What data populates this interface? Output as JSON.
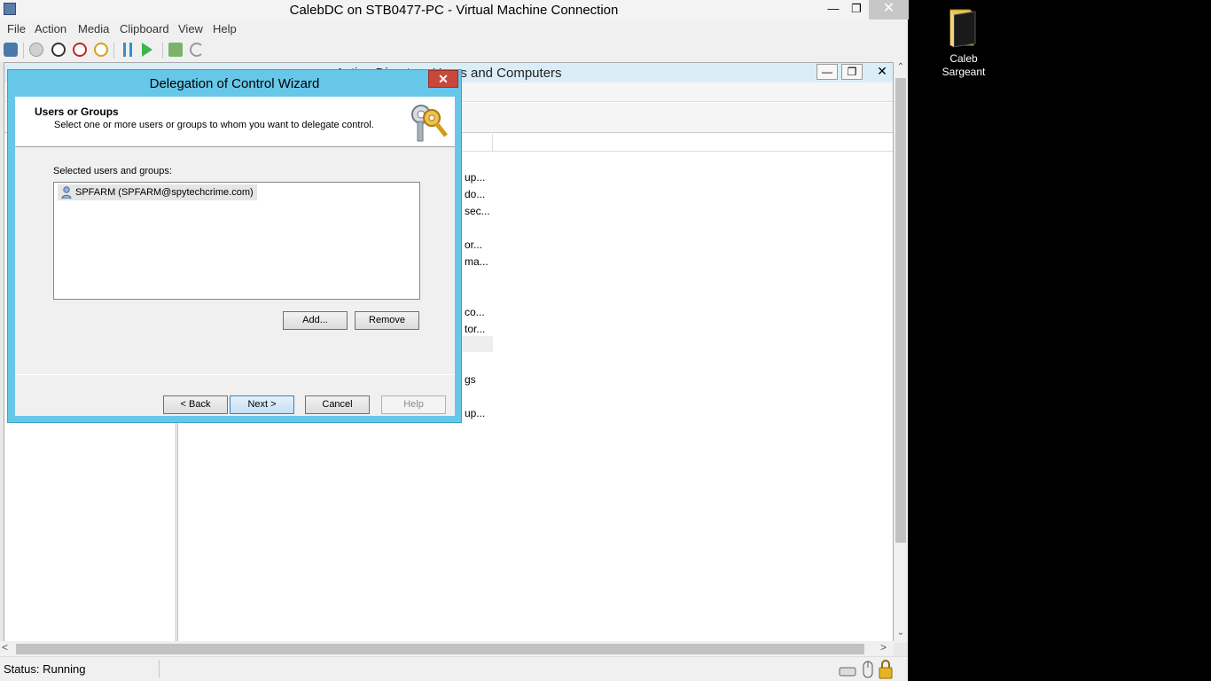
{
  "vm": {
    "title": "CalebDC on STB0477-PC - Virtual Machine Connection",
    "menu": [
      "File",
      "Action",
      "Media",
      "Clipboard",
      "View",
      "Help"
    ],
    "status": "Status: Running"
  },
  "aduc": {
    "title": "Active Directory Users and Computers",
    "descriptions": [
      "up...",
      "do...",
      "sec...",
      "or...",
      "ma...",
      "co...",
      "tor...",
      "gs",
      "up..."
    ]
  },
  "wizard": {
    "title": "Delegation of Control Wizard",
    "heading": "Users or Groups",
    "subheading": "Select one or more users or groups to whom you want to delegate control.",
    "list_label": "Selected users and groups:",
    "selected_items": [
      "SPFARM (SPFARM@spytechcrime.com)"
    ],
    "buttons": {
      "add": "Add...",
      "remove": "Remove",
      "back": "< Back",
      "next": "Next >",
      "cancel": "Cancel",
      "help": "Help"
    }
  },
  "desktop": {
    "folder_label_line1": "Caleb",
    "folder_label_line2": "Sargeant"
  },
  "colors": {
    "wizard_frame": "#67c7e9",
    "close_red": "#c9483c",
    "desktop_bg": "#000000"
  }
}
